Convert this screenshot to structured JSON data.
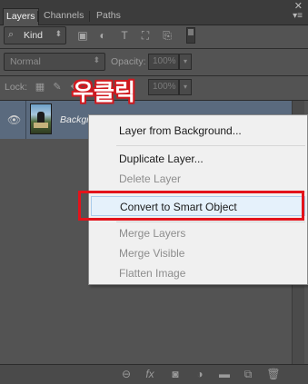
{
  "tabs": [
    {
      "label": "Layers",
      "active": true
    },
    {
      "label": "Channels",
      "active": false
    },
    {
      "label": "Paths",
      "active": false
    }
  ],
  "icons": {
    "close": "close-icon",
    "panel_menu": "panel-menu-icon"
  },
  "filter": {
    "kind_label": "Kind",
    "icons": [
      "image-filter-icon",
      "adjustment-filter-icon",
      "type-filter-icon",
      "shape-filter-icon",
      "smart-object-filter-icon"
    ]
  },
  "blend": {
    "mode": "Normal",
    "opacity_label": "Opacity:",
    "opacity_value": "100%"
  },
  "lock": {
    "label": "Lock:",
    "icons": [
      "lock-transparent-icon",
      "lock-image-icon",
      "lock-position-icon",
      "lock-all-icon"
    ],
    "fill_value": "100%"
  },
  "layer": {
    "name": "Background"
  },
  "annotation": "우클릭",
  "context_menu": {
    "items": [
      {
        "label": "Layer from Background...",
        "enabled": true
      },
      {
        "label": "Duplicate Layer...",
        "enabled": true
      },
      {
        "label": "Delete Layer",
        "enabled": false
      },
      {
        "label": "Convert to Smart Object",
        "enabled": true,
        "highlighted": true
      },
      {
        "label": "Merge Layers",
        "enabled": false
      },
      {
        "label": "Merge Visible",
        "enabled": false
      },
      {
        "label": "Flatten Image",
        "enabled": false
      }
    ]
  },
  "bottom_bar": {
    "icons": [
      "link-layers-icon",
      "fx-icon",
      "add-mask-icon",
      "adjustment-layer-icon",
      "group-folder-icon",
      "new-layer-icon",
      "delete-layer-icon"
    ],
    "fx_text": "fx"
  },
  "colors": {
    "panel_bg": "#535353",
    "selected_layer": "#5a6a7e",
    "annotation_red": "#e3131b",
    "menu_bg": "#f0f0f0"
  }
}
